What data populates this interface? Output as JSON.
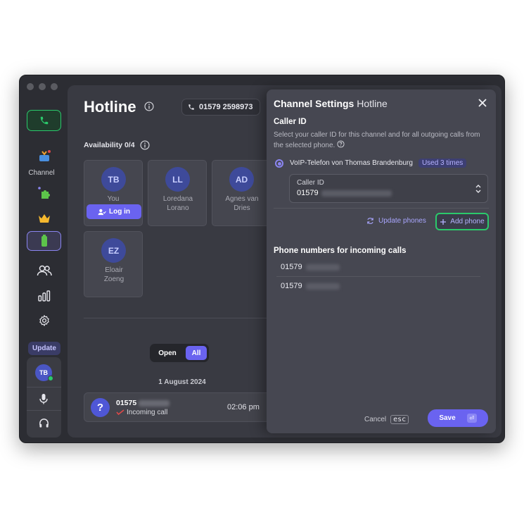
{
  "rail": {
    "channel_label": "Channel",
    "update_label": "Update",
    "user_initials": "TB"
  },
  "main": {
    "title": "Hotline",
    "phone_chip": "01579 2598973",
    "availability": "Availability 0/4",
    "agents": [
      {
        "initials": "TB",
        "name": "You",
        "action": "Log in"
      },
      {
        "initials": "LL",
        "name": "Loredana Lorano"
      },
      {
        "initials": "AD",
        "name": "Agnes van Dries"
      },
      {
        "initials": "EZ",
        "name": "Eloair Zoeng"
      }
    ],
    "filter": {
      "open": "Open",
      "all": "All"
    },
    "date_separator": "1 August 2024",
    "call": {
      "number_prefix": "01575",
      "status": "Incoming call",
      "time": "02:06 pm",
      "icon": "?"
    }
  },
  "panel": {
    "title_bold": "Channel Settings",
    "title_rest": "Hotline",
    "caller_id_heading": "Caller ID",
    "caller_id_desc": "Select your caller ID for this channel and for all outgoing calls from the selected phone.",
    "phone_option": "VoIP-Telefon von Thomas Brandenburg",
    "used_badge": "Used 3 times",
    "select_label": "Caller ID",
    "select_value_prefix": "01579",
    "update_phones": "Update phones",
    "add_phone": "Add phone",
    "incoming_heading": "Phone numbers for incoming calls",
    "incoming_numbers": [
      "01579",
      "01579"
    ],
    "cancel": "Cancel",
    "cancel_key": "esc",
    "save": "Save"
  },
  "colors": {
    "accent": "#6a63f0",
    "success": "#2bc96b",
    "panel_bg": "#464751"
  }
}
